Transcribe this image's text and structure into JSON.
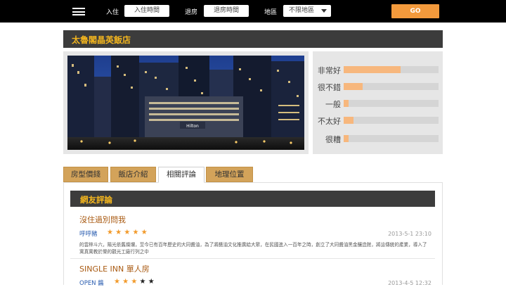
{
  "header": {
    "checkin_label": "入住",
    "checkin_placeholder": "入住時間",
    "checkout_label": "退房",
    "checkout_placeholder": "退房時間",
    "area_label": "地區",
    "area_value": "不限地區",
    "go_label": "GO"
  },
  "hotel": {
    "name": "太魯閣晶英飯店"
  },
  "ratings": [
    {
      "label": "非常好",
      "fraction": 0.6
    },
    {
      "label": "很不錯",
      "fraction": 0.2
    },
    {
      "label": "一般",
      "fraction": 0.05
    },
    {
      "label": "不太好",
      "fraction": 0.1
    },
    {
      "label": "很糟",
      "fraction": 0.05
    }
  ],
  "tabs": [
    {
      "label": "房型價錢",
      "active": false
    },
    {
      "label": "飯店介紹",
      "active": false
    },
    {
      "label": "相關評論",
      "active": true
    },
    {
      "label": "地理位置",
      "active": false
    }
  ],
  "reviews_section": {
    "title": "網友評論"
  },
  "reviews": [
    {
      "title": "沒住過別問我",
      "user": "呼呼豬",
      "stars": 5,
      "date": "2013-5-1 23:10",
      "body": "的雲林斗六，陽光依舊燦爛，至今已有百年歷史的大同醬油，為了將醬油文化推廣給大眾，在民國進入一百年之時，創立了大同醬油黑金釀造館，將這傳統的產業，導入了寓真寓教於樂的觀光工廠行列之中"
    },
    {
      "title": "SINGLE INN 單人房",
      "user": "OPEN 醬",
      "stars": 3,
      "date": "2013-4-5 12:32",
      "body": ""
    }
  ],
  "colors": {
    "accent": "#f4b61e",
    "go_button": "#f39a3c",
    "rating_fill": "#f7b77d",
    "tab": "#d3a35a"
  }
}
